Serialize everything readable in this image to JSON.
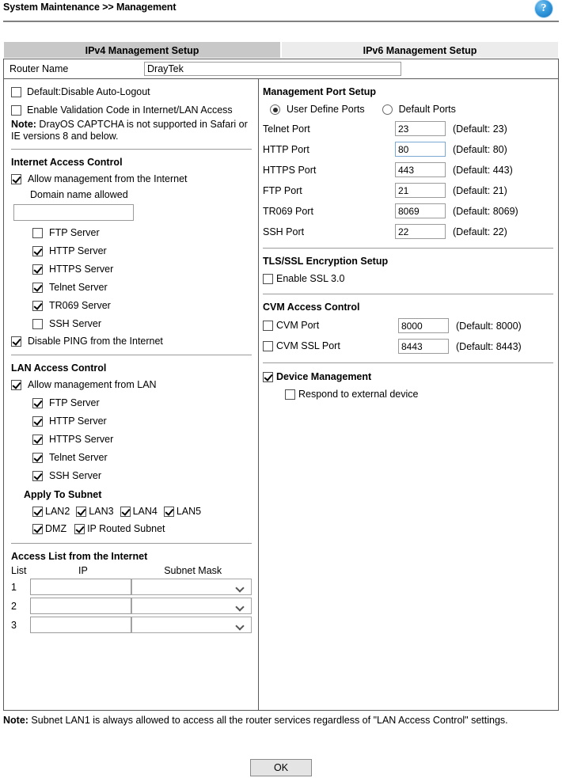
{
  "header": {
    "breadcrumb": "System Maintenance >> Management",
    "help_icon_glyph": "?",
    "help_icon_color": "#3399dd"
  },
  "tabs": [
    {
      "label": "IPv4 Management Setup",
      "active": true
    },
    {
      "label": "IPv6 Management Setup",
      "active": false
    }
  ],
  "router_name": {
    "label": "Router Name",
    "value": "DrayTek"
  },
  "left": {
    "default_disable_auto_logout": {
      "label": "Default:Disable Auto-Logout",
      "checked": false
    },
    "enable_validation_code": {
      "label": "Enable Validation Code in Internet/LAN Access",
      "checked": false
    },
    "captcha_note_prefix": "Note:",
    "captcha_note": " DrayOS CAPTCHA is not supported in Safari or IE versions 8 and below.",
    "internet_access_control": {
      "title": "Internet Access Control",
      "allow_management": {
        "label": "Allow management from the Internet",
        "checked": true
      },
      "domain_name_allowed_label": "Domain name allowed",
      "domain_name_allowed_value": "",
      "servers": [
        {
          "label": "FTP Server",
          "checked": false
        },
        {
          "label": "HTTP Server",
          "checked": true
        },
        {
          "label": "HTTPS Server",
          "checked": true
        },
        {
          "label": "Telnet Server",
          "checked": true
        },
        {
          "label": "TR069 Server",
          "checked": true
        },
        {
          "label": "SSH Server",
          "checked": false
        }
      ],
      "disable_ping": {
        "label": "Disable PING from the Internet",
        "checked": true
      }
    },
    "lan_access_control": {
      "title": "LAN Access Control",
      "allow_management": {
        "label": "Allow management from LAN",
        "checked": true
      },
      "servers": [
        {
          "label": "FTP Server",
          "checked": true
        },
        {
          "label": "HTTP Server",
          "checked": true
        },
        {
          "label": "HTTPS Server",
          "checked": true
        },
        {
          "label": "Telnet Server",
          "checked": true
        },
        {
          "label": "SSH Server",
          "checked": true
        }
      ],
      "apply_to_subnet_title": "Apply To Subnet",
      "subnets_row1": [
        {
          "label": "LAN2",
          "checked": true
        },
        {
          "label": "LAN3",
          "checked": true
        },
        {
          "label": "LAN4",
          "checked": true
        },
        {
          "label": "LAN5",
          "checked": true
        }
      ],
      "subnets_row2": [
        {
          "label": "DMZ",
          "checked": true
        },
        {
          "label": "IP Routed Subnet",
          "checked": true
        }
      ]
    },
    "access_list": {
      "title": "Access List from the Internet",
      "columns": [
        "List",
        "IP",
        "Subnet Mask"
      ],
      "rows": [
        {
          "index": "1",
          "ip": "",
          "mask": ""
        },
        {
          "index": "2",
          "ip": "",
          "mask": ""
        },
        {
          "index": "3",
          "ip": "",
          "mask": ""
        }
      ]
    }
  },
  "right": {
    "management_port_setup": {
      "title": "Management Port Setup",
      "mode_options": [
        {
          "label": "User Define Ports",
          "selected": true
        },
        {
          "label": "Default Ports",
          "selected": false
        }
      ],
      "ports": [
        {
          "label": "Telnet Port",
          "value": "23",
          "default": "(Default: 23)",
          "focused": false
        },
        {
          "label": "HTTP Port",
          "value": "80",
          "default": "(Default: 80)",
          "focused": true
        },
        {
          "label": "HTTPS Port",
          "value": "443",
          "default": "(Default: 443)",
          "focused": false
        },
        {
          "label": "FTP Port",
          "value": "21",
          "default": "(Default: 21)",
          "focused": false
        },
        {
          "label": "TR069 Port",
          "value": "8069",
          "default": "(Default: 8069)",
          "focused": false
        },
        {
          "label": "SSH Port",
          "value": "22",
          "default": "(Default: 22)",
          "focused": false
        }
      ]
    },
    "tls_ssl": {
      "title": "TLS/SSL Encryption Setup",
      "enable_ssl3": {
        "label": "Enable SSL 3.0",
        "checked": false
      }
    },
    "cvm_access_control": {
      "title": "CVM Access Control",
      "ports": [
        {
          "label": "CVM Port",
          "checked": false,
          "value": "8000",
          "default": "(Default: 8000)"
        },
        {
          "label": "CVM SSL Port",
          "checked": false,
          "value": "8443",
          "default": "(Default: 8443)"
        }
      ]
    },
    "device_management": {
      "label": "Device Management",
      "checked": true,
      "respond_external": {
        "label": "Respond to external device",
        "checked": false
      }
    }
  },
  "footer": {
    "note_prefix": "Note:",
    "note": " Subnet LAN1 is always allowed to access all the router services regardless of \"LAN Access Control\" settings.",
    "ok_label": "OK"
  }
}
